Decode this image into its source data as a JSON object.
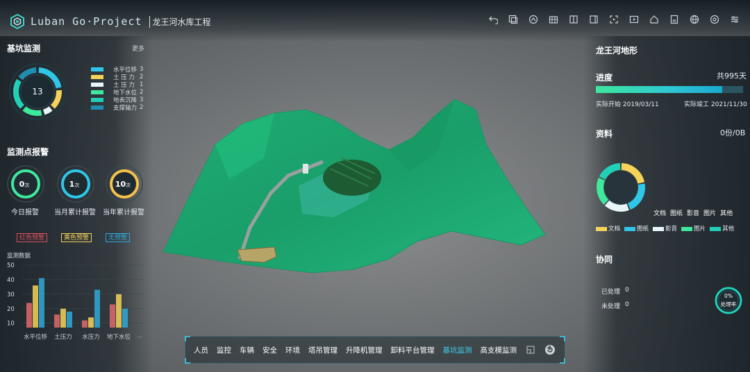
{
  "header": {
    "brand": "Luban Go·Project",
    "project": "龙王河水库工程",
    "tools": [
      "undo-icon",
      "copy-icon",
      "home-outline-icon",
      "grid-icon",
      "book-icon",
      "panel-icon",
      "focus-icon",
      "video-icon",
      "house-icon",
      "document-icon",
      "globe-icon",
      "target-icon",
      "settings-sliders-icon"
    ]
  },
  "left": {
    "monitor_title": "基坑监测",
    "more": "更多",
    "donut_total": "13",
    "legend": [
      {
        "label": "水平位移",
        "value": "3",
        "color": "#2fc6e8"
      },
      {
        "label": "土 压 力",
        "value": "2",
        "color": "#f5d35a"
      },
      {
        "label": "土 压 力",
        "value": "1",
        "color": "#e8f6fa"
      },
      {
        "label": "地下水位",
        "value": "2",
        "color": "#3ee89c"
      },
      {
        "label": "地表沉降",
        "value": "3",
        "color": "#22d0b8"
      },
      {
        "label": "支撑轴力",
        "value": "2",
        "color": "#1e8fb0"
      }
    ],
    "alarm_title": "监测点报警",
    "alarms": [
      {
        "value": "0",
        "unit": "次",
        "label": "今日报警",
        "color": "#3ee89c"
      },
      {
        "value": "1",
        "unit": "次",
        "label": "当月累计报警",
        "color": "#2fc6e8"
      },
      {
        "value": "10",
        "unit": "次",
        "label": "当年累计报警",
        "color": "#f5c04a"
      }
    ],
    "tags": [
      {
        "label": "红色预警",
        "color": "#e0505a"
      },
      {
        "label": "黄色预警",
        "color": "#f5d35a"
      },
      {
        "label": "无预警",
        "color": "#2fa9d8"
      }
    ],
    "chart_title": "监测数据"
  },
  "chart_data": {
    "type": "bar",
    "categories": [
      "水平位移",
      "土压力",
      "水压力",
      "地下水位"
    ],
    "series": [
      {
        "values": [
          24,
          16,
          12,
          23
        ],
        "color": "#e06a6a"
      },
      {
        "values": [
          36,
          20,
          14,
          30
        ],
        "color": "#f5d35a"
      },
      {
        "values": [
          41,
          18,
          33,
          20
        ],
        "color": "#2fa9d8"
      }
    ],
    "y_ticks": [
      10,
      20,
      30,
      40,
      50
    ],
    "ylim": [
      7,
      50
    ],
    "overflow_label": "—"
  },
  "right": {
    "terrain_title": "龙王河地形",
    "progress_title": "进度",
    "total_days": "共995天",
    "progress_fraction": 0.86,
    "start_label": "实际开始 2019/03/11",
    "end_label": "实际竣工 2021/11/30",
    "docs_title": "资料",
    "docs_count": "0份/0B",
    "doc_categories": [
      "文档",
      "图纸",
      "影音",
      "图片",
      "其他"
    ],
    "doc_legend": [
      {
        "label": "文档",
        "color": "#f5d35a"
      },
      {
        "label": "图纸",
        "color": "#2fc6e8"
      },
      {
        "label": "影音",
        "color": "#e8f6fa"
      },
      {
        "label": "图片",
        "color": "#3ee89c"
      },
      {
        "label": "其他",
        "color": "#22d0b8"
      }
    ],
    "collab_title": "协同",
    "handled_label": "已处理",
    "handled_value": "0",
    "unhandled_label": "未处理",
    "unhandled_value": "0",
    "rate_value": "0%",
    "rate_label": "处理率"
  },
  "bottom_nav": {
    "items": [
      "人员",
      "监控",
      "车辆",
      "安全",
      "环境",
      "塔吊管理",
      "升降机管理",
      "卸料平台管理",
      "基坑监测",
      "高支模监测"
    ],
    "active": "基坑监测"
  }
}
